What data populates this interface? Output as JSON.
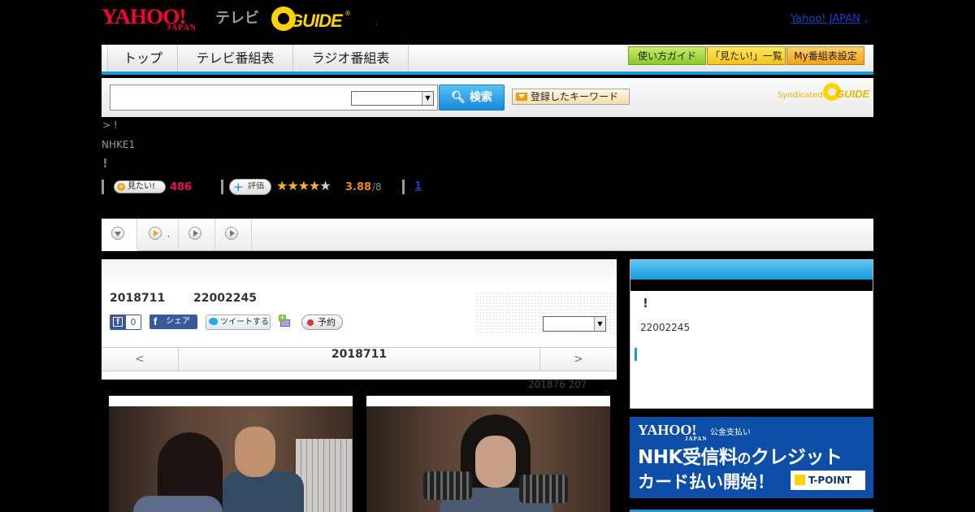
{
  "header": {
    "yahoo_logo": "YAHOO!",
    "yahoo_sub": "JAPAN",
    "tv_label": "テレビ",
    "gguide_logo": "GUIDE",
    "gguide_reg": "®",
    "tiny_mark": ",",
    "yahoo_japan_link": "Yahoo! JAPAN",
    "yahoo_japan_arrow": ","
  },
  "nav": {
    "tabs": [
      {
        "label": "トップ"
      },
      {
        "label": "テレビ番組表"
      },
      {
        "label": "ラジオ番組表"
      }
    ],
    "right_buttons": [
      {
        "label": "使い方ガイド",
        "color": "#8bc92a"
      },
      {
        "label": "「見たい!」一覧",
        "color": "#f5c21c"
      },
      {
        "label": "My番組表設定",
        "color": "#f3a11c"
      }
    ]
  },
  "search": {
    "input_value": "",
    "button_label": "検索",
    "keyword_button": "登録したキーワード",
    "syndicated_label": "Syndicated",
    "syn_logo": "GUIDE"
  },
  "program": {
    "breadcrumb": "> !",
    "channel": "NHKE1",
    "title": "!",
    "mitai_label": "見たい!",
    "mitai_count": "486",
    "hyoka_label": "評価",
    "rating_value": 3.88,
    "rating_text": "3.88",
    "rating_of": "/8",
    "rating_link": "1",
    "tab_dot": ","
  },
  "main": {
    "broadcast_date": "2018711",
    "broadcast_time": "22002245",
    "fb_like_count": "0",
    "fb_share_label": "シェア",
    "tweet_label": "ツイートする",
    "gift_badge": "+",
    "yoyaku_label": "予約",
    "date_nav": {
      "prev": "<",
      "current": "2018711",
      "next": ">"
    },
    "updated": "201876  207"
  },
  "side": {
    "title": "!",
    "time": "22002245"
  },
  "ad": {
    "logo": "YAHOO!",
    "logo_sub": "JAPAN",
    "pay_label": "公金支払い",
    "line1_a": "NHK受信料",
    "line1_b": "の",
    "line1_c": "クレジット",
    "line2": "カード払い開始！",
    "tpoint": "T-POINT"
  },
  "colors": {
    "accent_blue": "#1a99dc",
    "mitai_pink": "#e2164e",
    "rating_orange": "#e28a1a",
    "ad_blue": "#0d4fa8"
  }
}
